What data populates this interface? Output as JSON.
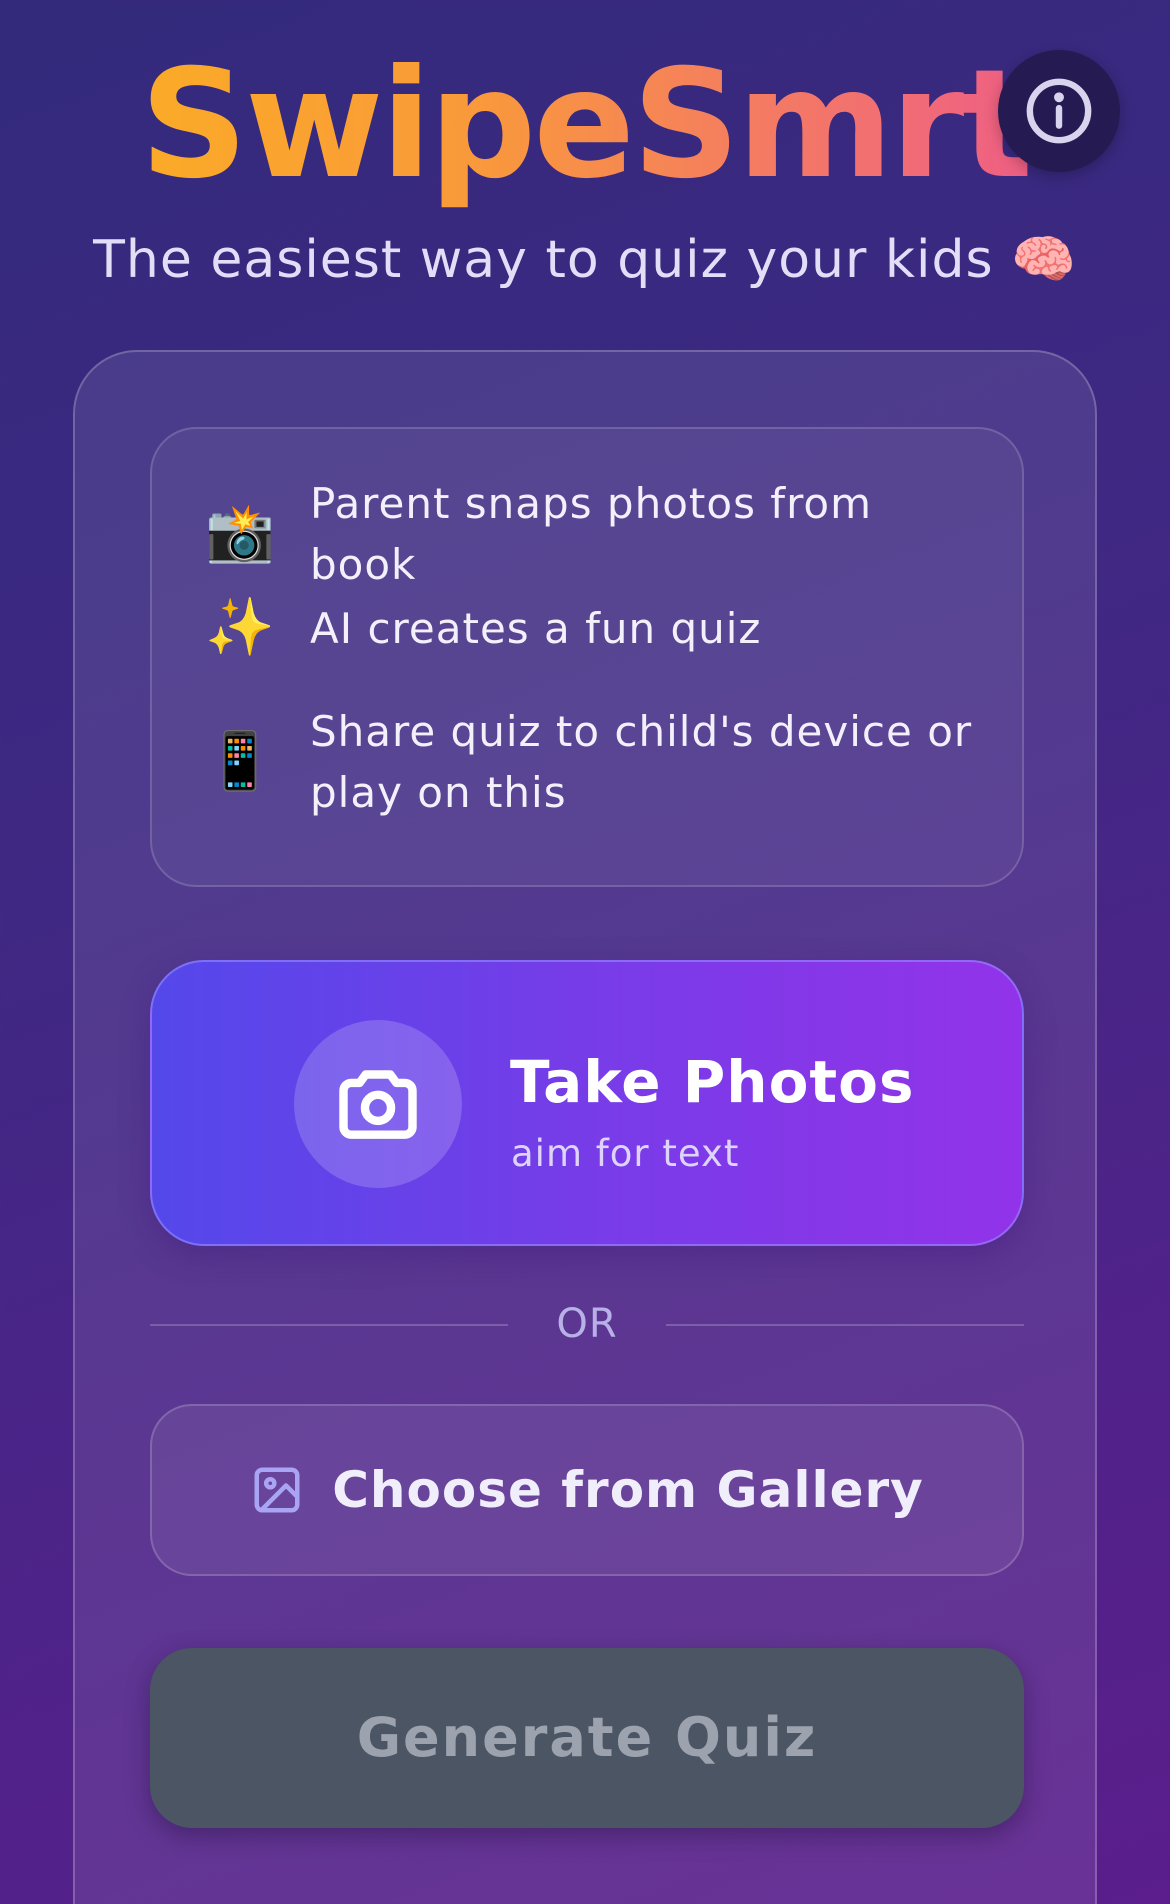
{
  "header": {
    "app_title": "SwipeSmrt",
    "tagline": "The easiest way to quiz your kids 🧠",
    "info_icon": "info-icon"
  },
  "steps": [
    {
      "icon": "📸",
      "icon_name": "camera-flash-icon",
      "text": "Parent snaps photos from book"
    },
    {
      "icon": "✨",
      "icon_name": "sparkles-icon",
      "text": "AI creates a fun quiz"
    },
    {
      "icon": "📱",
      "icon_name": "mobile-phone-icon",
      "text": "Share quiz to child's device or play on this"
    }
  ],
  "take_photos": {
    "label": "Take Photos",
    "sublabel": "aim for text",
    "icon": "camera-icon"
  },
  "divider": {
    "label": "OR"
  },
  "gallery": {
    "label": "Choose from Gallery",
    "icon": "image-icon"
  },
  "generate": {
    "label": "Generate Quiz",
    "state": "disabled"
  },
  "colors": {
    "title_gradient_start": "#fbb21f",
    "title_gradient_end": "#ea4f94",
    "primary_button_start": "#5448ea",
    "primary_button_end": "#9233e9",
    "disabled_button": "#4b5563",
    "disabled_text": "#9ca3af"
  }
}
